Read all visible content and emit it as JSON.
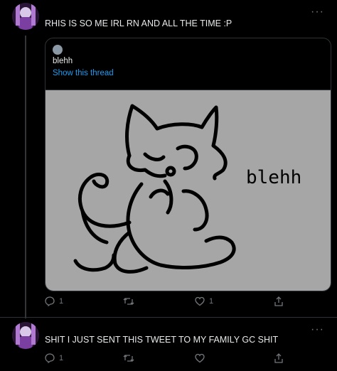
{
  "tweet1": {
    "text": "RHIS IS SO ME IRL RN AND ALL THE TIME :P",
    "more_label": "···",
    "quote": {
      "name": "blehh",
      "show_thread": "Show this thread",
      "image_text": "blehh"
    },
    "actions": {
      "reply_count": "1",
      "retweet_count": "",
      "like_count": "1"
    }
  },
  "tweet2": {
    "text": "SHIT I JUST SENT THIS TWEET TO MY FAMILY GC SHIT",
    "more_label": "···",
    "actions": {
      "reply_count": "1",
      "retweet_count": "",
      "like_count": ""
    }
  },
  "colors": {
    "background": "#000000",
    "text": "#e7e9ea",
    "muted": "#71767b",
    "link": "#1d9bf0",
    "border": "#2f3336",
    "media_bg": "#a6a6a6"
  },
  "icons": [
    "more-icon",
    "reply-icon",
    "retweet-icon",
    "like-icon",
    "share-icon"
  ]
}
